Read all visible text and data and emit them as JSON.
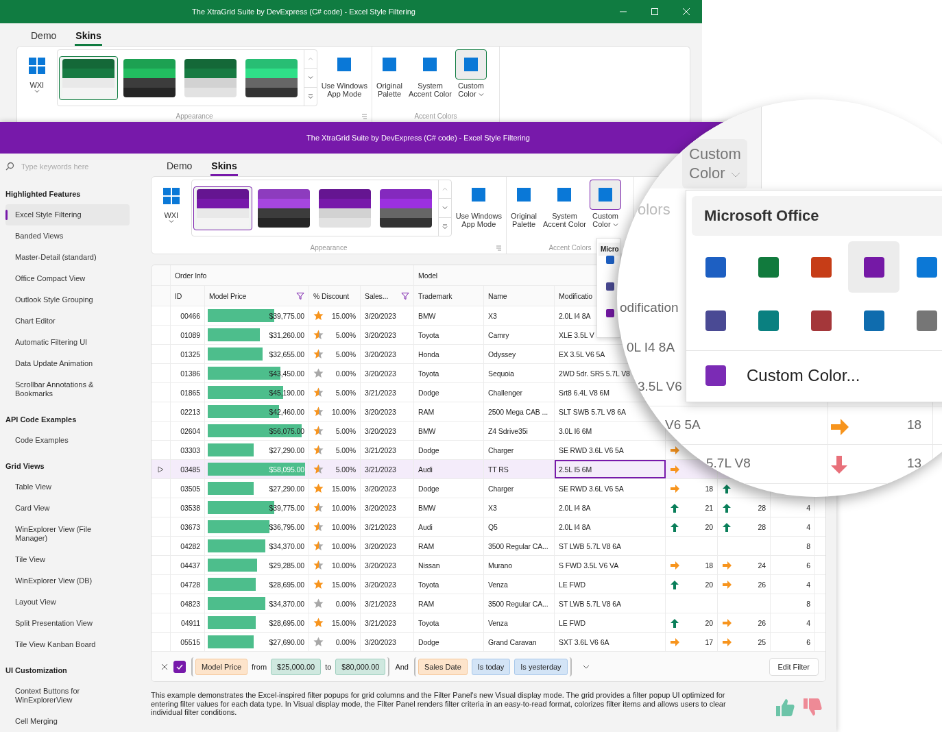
{
  "top_window": {
    "title": "The XtraGrid Suite by DevExpress (C# code) - Excel Style Filtering",
    "color": "#107c41",
    "caption_buttons": true,
    "tabs": [
      {
        "label": "Demo",
        "selected": false
      },
      {
        "label": "Skins",
        "selected": true
      }
    ],
    "ribbon": {
      "theme_button": "WXI",
      "skins": [
        {
          "color": "#177a42",
          "kind": "light",
          "selected": true
        },
        {
          "color": "#22bd60",
          "kind": "dark",
          "selected": false
        },
        {
          "color": "#177a42",
          "kind": "grey",
          "selected": false
        },
        {
          "color": "#2fe088",
          "kind": "dim",
          "selected": false
        }
      ],
      "app_mode": "Use Windows\nApp Mode",
      "appearance_label": "Appearance",
      "accent_buttons": [
        {
          "label": "Original\nPalette",
          "selected": false,
          "dropdown": false
        },
        {
          "label": "System\nAccent Color",
          "selected": false,
          "dropdown": false
        },
        {
          "label": "Custom\nColor",
          "selected": true,
          "dropdown": true
        }
      ],
      "accent_label": "Accent Colors"
    }
  },
  "main_window": {
    "title": "The XtraGrid Suite by DevExpress (C# code) - Excel Style Filtering",
    "color": "#7719aa",
    "caption_buttons": false,
    "tabs": [
      {
        "label": "Demo",
        "selected": false
      },
      {
        "label": "Skins",
        "selected": true
      }
    ],
    "ribbon": {
      "theme_button": "WXI",
      "skins": [
        {
          "color": "#7719aa",
          "kind": "light",
          "selected": true
        },
        {
          "color": "#a646e0",
          "kind": "dark",
          "selected": false
        },
        {
          "color": "#7719aa",
          "kind": "grey",
          "selected": false
        },
        {
          "color": "#9b30e0",
          "kind": "dim",
          "selected": false
        }
      ],
      "app_mode": "Use Windows\nApp Mode",
      "appearance_label": "Appearance",
      "accent_buttons": [
        {
          "label": "Original\nPalette",
          "selected": false,
          "dropdown": false
        },
        {
          "label": "System\nAccent Color",
          "selected": false,
          "dropdown": false
        },
        {
          "label": "Custom\nColor",
          "selected": true,
          "dropdown": true
        }
      ],
      "accent_label": "Accent Colors"
    }
  },
  "sidebar": {
    "search_placeholder": "Type keywords here",
    "groups": [
      {
        "title": "Highlighted Features",
        "items": [
          {
            "label": "Excel Style Filtering",
            "selected": true
          },
          {
            "label": "Banded Views",
            "selected": false
          },
          {
            "label": "Master-Detail (standard)",
            "selected": false
          },
          {
            "label": "Office Compact View",
            "selected": false
          },
          {
            "label": "Outlook Style Grouping",
            "selected": false
          },
          {
            "label": "Chart Editor",
            "selected": false
          },
          {
            "label": "Automatic Filtering UI",
            "selected": false
          },
          {
            "label": "Data Update Animation",
            "selected": false
          },
          {
            "label": "Scrollbar Annotations & Bookmarks",
            "selected": false
          }
        ]
      },
      {
        "title": "API Code Examples",
        "items": [
          {
            "label": "Code Examples",
            "selected": false
          }
        ]
      },
      {
        "title": "Grid Views",
        "items": [
          {
            "label": "Table View",
            "selected": false
          },
          {
            "label": "Card View",
            "selected": false
          },
          {
            "label": "WinExplorer View (File Manager)",
            "selected": false
          },
          {
            "label": "Tile View",
            "selected": false
          },
          {
            "label": "WinExplorer View (DB)",
            "selected": false
          },
          {
            "label": "Layout View",
            "selected": false
          },
          {
            "label": "Split Presentation View",
            "selected": false
          },
          {
            "label": "Tile View Kanban Board",
            "selected": false
          }
        ]
      },
      {
        "title": "UI Customization",
        "items": [
          {
            "label": "Context Buttons for WinExplorerView",
            "selected": false
          },
          {
            "label": "Cell Merging",
            "selected": false
          }
        ]
      }
    ]
  },
  "accent_popup": {
    "title": "Micro",
    "swatches": [
      {
        "color": "#1d5fc2"
      },
      {
        "color": "#4a4a94"
      },
      {
        "color": "#7519a6"
      }
    ]
  },
  "grid": {
    "bands": [
      {
        "label": "Order Info",
        "columns": [
          {
            "label": "ID"
          },
          {
            "label": "Model Price",
            "filtered": true
          },
          {
            "label": "% Discount"
          },
          {
            "label": "Sales...",
            "filtered": true
          }
        ]
      },
      {
        "label": "Model",
        "columns": [
          {
            "label": "Trademark"
          },
          {
            "label": "Name"
          },
          {
            "label": "Modificatio"
          }
        ]
      }
    ],
    "rows": [
      {
        "id": "00466",
        "price": "$39,775.00",
        "level": 0.68,
        "discount": {
          "kind": "full",
          "text": "15.00%"
        },
        "date": "3/20/2023",
        "trademark": "BMW",
        "name": "X3",
        "modification": "2.0L I4 8A",
        "selected": false
      },
      {
        "id": "01089",
        "price": "$31,260.00",
        "level": 0.53,
        "discount": {
          "kind": "half",
          "text": "5.00%"
        },
        "date": "3/20/2023",
        "trademark": "Toyota",
        "name": "Camry",
        "modification": "XLE 3.5L V",
        "selected": false
      },
      {
        "id": "01325",
        "price": "$32,655.00",
        "level": 0.56,
        "discount": {
          "kind": "half",
          "text": "5.00%"
        },
        "date": "3/20/2023",
        "trademark": "Honda",
        "name": "Odyssey",
        "modification": "EX 3.5L V6 5A",
        "selected": false
      },
      {
        "id": "01386",
        "price": "$43,450.00",
        "level": 0.74,
        "discount": {
          "kind": "empty",
          "text": "0.00%"
        },
        "date": "3/20/2023",
        "trademark": "Toyota",
        "name": "Sequoia",
        "modification": "2WD 5dr. SR5 5.7L V8",
        "selected": false
      },
      {
        "id": "01865",
        "price": "$45,190.00",
        "level": 0.77,
        "discount": {
          "kind": "half",
          "text": "5.00%"
        },
        "date": "3/21/2023",
        "trademark": "Dodge",
        "name": "Challenger",
        "modification": "Srt8 6.4L V8 6M",
        "selected": false
      },
      {
        "id": "02213",
        "price": "$42,460.00",
        "level": 0.73,
        "discount": {
          "kind": "half",
          "text": "10.00%"
        },
        "date": "3/20/2023",
        "trademark": "RAM",
        "name": "2500 Mega CAB ...",
        "modification": "SLT SWB 5.7L V8 6A",
        "selected": false
      },
      {
        "id": "02604",
        "price": "$56,075.00",
        "level": 0.96,
        "discount": {
          "kind": "half",
          "text": "5.00%"
        },
        "date": "3/20/2023",
        "trademark": "BMW",
        "name": "Z4 Sdrive35i",
        "modification": "3.0L I6 6M",
        "selected": false
      },
      {
        "id": "03303",
        "price": "$27,290.00",
        "level": 0.47,
        "discount": {
          "kind": "half",
          "text": "5.00%"
        },
        "date": "3/21/2023",
        "trademark": "Dodge",
        "name": "Charger",
        "modification": "SE RWD 3.6L V6 5A",
        "city": {
          "kind": "right"
        },
        "selected": false
      },
      {
        "id": "03485",
        "price": "$58,095.00",
        "level": 0.99,
        "discount": {
          "kind": "half",
          "text": "5.00%"
        },
        "date": "3/21/2023",
        "trademark": "Audi",
        "name": "TT RS",
        "modification": "2.5L I5 6M",
        "city": {
          "kind": "right"
        },
        "selected": true
      },
      {
        "id": "03505",
        "price": "$27,290.00",
        "level": 0.47,
        "discount": {
          "kind": "full",
          "text": "15.00%"
        },
        "date": "3/20/2023",
        "trademark": "Dodge",
        "name": "Charger",
        "modification": "SE RWD 3.6L V6 5A",
        "city": {
          "kind": "right",
          "value": "18"
        },
        "highway": {
          "kind": "up"
        },
        "selected": false
      },
      {
        "id": "03538",
        "price": "$39,775.00",
        "level": 0.68,
        "discount": {
          "kind": "half",
          "text": "10.00%"
        },
        "date": "3/20/2023",
        "trademark": "BMW",
        "name": "X3",
        "modification": "2.0L I4 8A",
        "city": {
          "kind": "up",
          "value": "21"
        },
        "highway": {
          "kind": "up",
          "value": "28"
        },
        "cylinders": "4",
        "selected": false
      },
      {
        "id": "03673",
        "price": "$36,795.00",
        "level": 0.63,
        "discount": {
          "kind": "half",
          "text": "10.00%"
        },
        "date": "3/21/2023",
        "trademark": "Audi",
        "name": "Q5",
        "modification": "2.0L I4 8A",
        "city": {
          "kind": "up",
          "value": "20"
        },
        "highway": {
          "kind": "up",
          "value": "28"
        },
        "cylinders": "4",
        "selected": false
      },
      {
        "id": "04282",
        "price": "$34,370.00",
        "level": 0.59,
        "discount": {
          "kind": "half",
          "text": "10.00%"
        },
        "date": "3/20/2023",
        "trademark": "RAM",
        "name": "3500 Regular CA...",
        "modification": "ST LWB 5.7L V8 6A",
        "cylinders": "8",
        "selected": false
      },
      {
        "id": "04437",
        "price": "$29,285.00",
        "level": 0.5,
        "discount": {
          "kind": "half",
          "text": "10.00%"
        },
        "date": "3/20/2023",
        "trademark": "Nissan",
        "name": "Murano",
        "modification": "S FWD 3.5L V6 VA",
        "city": {
          "kind": "right",
          "value": "18"
        },
        "highway": {
          "kind": "right",
          "value": "24"
        },
        "cylinders": "6",
        "selected": false
      },
      {
        "id": "04728",
        "price": "$28,695.00",
        "level": 0.49,
        "discount": {
          "kind": "full",
          "text": "15.00%"
        },
        "date": "3/20/2023",
        "trademark": "Toyota",
        "name": "Venza",
        "modification": "LE FWD",
        "city": {
          "kind": "up",
          "value": "20"
        },
        "highway": {
          "kind": "right",
          "value": "26"
        },
        "cylinders": "4",
        "selected": false
      },
      {
        "id": "04823",
        "price": "$34,370.00",
        "level": 0.59,
        "discount": {
          "kind": "empty",
          "text": "0.00%"
        },
        "date": "3/21/2023",
        "trademark": "RAM",
        "name": "3500 Regular CA...",
        "modification": "ST LWB 5.7L V8 6A",
        "cylinders": "8",
        "selected": false
      },
      {
        "id": "04911",
        "price": "$28,695.00",
        "level": 0.49,
        "discount": {
          "kind": "full",
          "text": "15.00%"
        },
        "date": "3/21/2023",
        "trademark": "Toyota",
        "name": "Venza",
        "modification": "LE FWD",
        "city": {
          "kind": "up",
          "value": "20"
        },
        "highway": {
          "kind": "right",
          "value": "26"
        },
        "cylinders": "4",
        "selected": false
      },
      {
        "id": "05515",
        "price": "$27,690.00",
        "level": 0.47,
        "discount": {
          "kind": "empty",
          "text": "0.00%"
        },
        "date": "3/20/2023",
        "trademark": "Dodge",
        "name": "Grand Caravan",
        "modification": "SXT 3.6L V6 6A",
        "city": {
          "kind": "right",
          "value": "17"
        },
        "highway": {
          "kind": "right",
          "value": "25"
        },
        "cylinders": "6",
        "selected": false
      }
    ],
    "filter_panel": {
      "enabled": true,
      "criteria": [
        {
          "kind": "group",
          "items": [
            {
              "kind": "field",
              "text": "Model Price"
            },
            {
              "kind": "word",
              "text": "from"
            },
            {
              "kind": "value",
              "text": "$25,000.00"
            },
            {
              "kind": "word",
              "text": "to"
            },
            {
              "kind": "value",
              "text": "$80,000.00"
            }
          ]
        },
        {
          "kind": "word",
          "text": "And"
        },
        {
          "kind": "group",
          "items": [
            {
              "kind": "field",
              "text": "Sales Date"
            },
            {
              "kind": "option",
              "text": "Is today"
            },
            {
              "kind": "option",
              "text": "Is yesterday"
            }
          ]
        }
      ],
      "edit_button": "Edit Filter"
    }
  },
  "description": "This example demonstrates the Excel-inspired filter popups for grid columns and the Filter Panel's new Visual display mode. The grid provides a filter popup UI optimized for entering filter values for each data type. In Visual display mode, the Filter Panel renders filter criteria in an easy-to-read format, colorizes filter items and allows users to clear individual filter conditions.",
  "magnifier": {
    "button": "Custom\nColor",
    "group_label": "olors",
    "palette": {
      "title": "Microsoft Office",
      "swatches": [
        {
          "color": "#1d5fc2",
          "selected": false
        },
        {
          "color": "#117a3d",
          "selected": false
        },
        {
          "color": "#c63d17",
          "selected": false
        },
        {
          "color": "#7519a6",
          "selected": true
        },
        {
          "color": "#0c78d6",
          "selected": false
        },
        {
          "color": "#4a4a94",
          "selected": false
        },
        {
          "color": "#0a8080",
          "selected": false
        },
        {
          "color": "#a4373a",
          "selected": false
        },
        {
          "color": "#0f6cae",
          "selected": false
        },
        {
          "color": "#767676",
          "selected": false
        }
      ],
      "custom": {
        "label": "Custom Color...",
        "color": "#7b2bb5"
      }
    },
    "cells": [
      {
        "text": "odification"
      },
      {
        "text": "0L I4 8A"
      },
      {
        "text": "3.5L V6"
      },
      {
        "text": "V6 5A"
      },
      {
        "text": "5.7L V8"
      },
      {
        "kind": "right",
        "value": "18"
      },
      {
        "kind": "down",
        "value": "13"
      }
    ]
  }
}
